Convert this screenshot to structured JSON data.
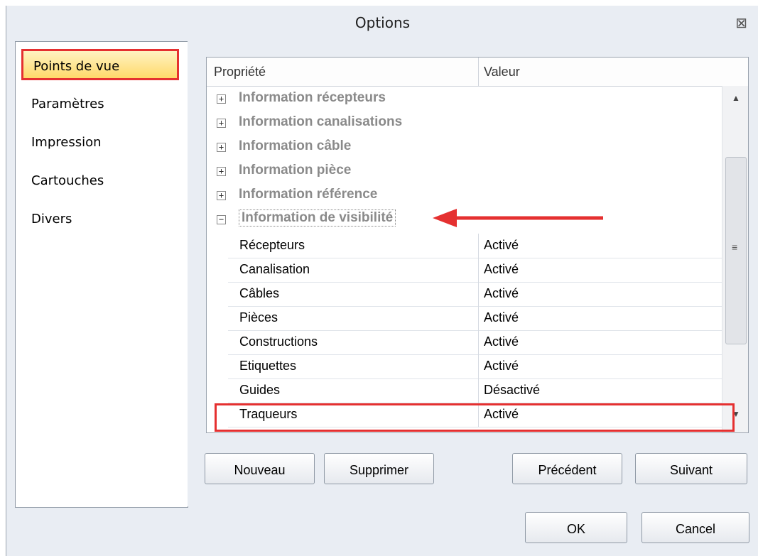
{
  "window": {
    "title": "Options",
    "close_glyph": "⊠"
  },
  "nav": {
    "items": [
      {
        "label": "Points de vue",
        "selected": true
      },
      {
        "label": "Paramètres",
        "selected": false
      },
      {
        "label": "Impression",
        "selected": false
      },
      {
        "label": "Cartouches",
        "selected": false
      },
      {
        "label": "Divers",
        "selected": false
      }
    ]
  },
  "grid": {
    "headers": {
      "property": "Propriété",
      "value": "Valeur"
    },
    "categories": [
      {
        "label": "Information récepteurs",
        "expander": "+"
      },
      {
        "label": "Information canalisations",
        "expander": "+"
      },
      {
        "label": "Information câble",
        "expander": "+"
      },
      {
        "label": "Information pièce",
        "expander": "+"
      },
      {
        "label": "Information référence",
        "expander": "+"
      },
      {
        "label": "Information de visibilité",
        "expander": "−"
      }
    ],
    "rows": [
      {
        "property": "Récepteurs",
        "value": "Activé"
      },
      {
        "property": "Canalisation",
        "value": "Activé"
      },
      {
        "property": "Câbles",
        "value": "Activé"
      },
      {
        "property": "Pièces",
        "value": "Activé"
      },
      {
        "property": "Constructions",
        "value": "Activé"
      },
      {
        "property": "Etiquettes",
        "value": "Activé"
      },
      {
        "property": "Guides",
        "value": "Désactivé"
      },
      {
        "property": "Traqueurs",
        "value": "Activé"
      }
    ],
    "scroll_up": "▲",
    "scroll_down": "▼",
    "scroll_grip": "≡"
  },
  "buttons": {
    "new": "Nouveau",
    "delete": "Supprimer",
    "previous": "Précédent",
    "next": "Suivant",
    "ok": "OK",
    "cancel": "Cancel"
  },
  "colors": {
    "highlight_red": "#e53030",
    "selected_nav": "#ffd96a",
    "dialog_bg": "#e9edf3"
  }
}
